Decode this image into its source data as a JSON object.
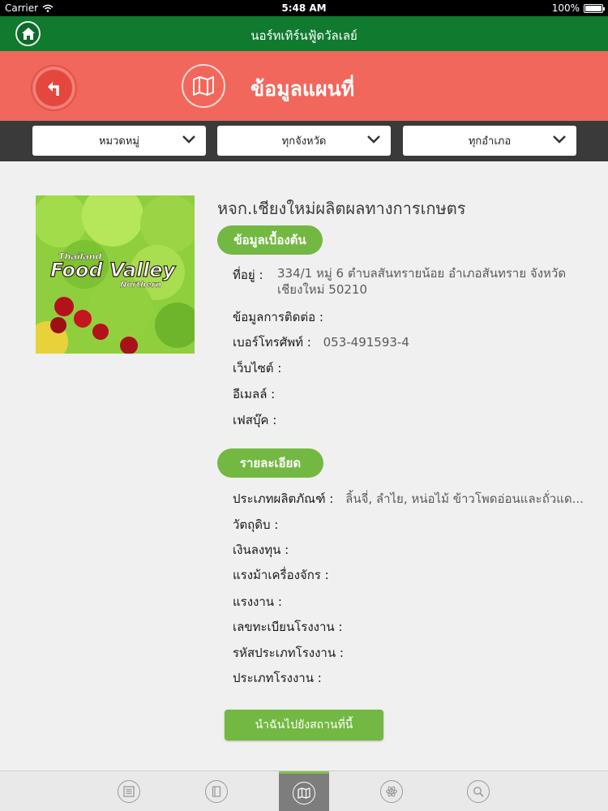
{
  "status_bar": {
    "carrier": "Carrier",
    "time": "5:48 AM",
    "battery": "100%"
  },
  "top_bar": {
    "title": "นอร์ทเทิร์นฟู้ดวัลเลย์"
  },
  "header": {
    "title": "ข้อมูลแผนที่"
  },
  "filters": [
    {
      "label": "หมวดหมู่"
    },
    {
      "label": "ทุกจังหวัด"
    },
    {
      "label": "ทุกอำเภอ"
    }
  ],
  "detail": {
    "company_name": "หจก.เชียงใหม่ผลิตผลทางการเกษตร",
    "image_text": {
      "line1": "Thailand",
      "line2": "Food Valley",
      "line3": "Northern"
    },
    "basic_section": "ข้อมูลเบื้องต้น",
    "address_label": "ที่อยู่ :",
    "address_value": "334/1 หมู่ 6 ตำบลสันทรายน้อย อำเภอสันทราย จังหวัด เชียงใหม่ 50210",
    "contact_label": "ข้อมูลการติดต่อ :",
    "phone_label": "เบอร์โทรศัพท์ :",
    "phone_value": "053-491593-4",
    "website_label": "เว็บไซต์ :",
    "email_label": "อีเมลล์ :",
    "facebook_label": "เฟสบุ๊ค :",
    "detail_section": "รายละเอียด",
    "product_type_label": "ประเภทผลิตภัณฑ์ :",
    "product_type_value": "ลิ้นจี่, ลำไย, หน่อไม้ ข้าวโพดอ่อนและถั่วแด...",
    "raw_material_label": "วัตถุดิบ :",
    "investment_label": "เงินลงทุน :",
    "horsepower_label": "แรงม้าเครื่องจักร :",
    "labor_label": "แรงงาน :",
    "factory_reg_label": "เลขทะเบียนโรงงาน :",
    "factory_code_label": "รหัสประเภทโรงงาน :",
    "factory_type_label": "ประเภทโรงงาน :",
    "navigate_button": "นำฉันไปยังสถานที่นี้"
  },
  "tab_bar": {
    "tabs": [
      {
        "icon": "news-icon",
        "active": false
      },
      {
        "icon": "book-icon",
        "active": false
      },
      {
        "icon": "map-icon",
        "active": true
      },
      {
        "icon": "atom-icon",
        "active": false
      },
      {
        "icon": "search-icon",
        "active": false
      }
    ]
  },
  "colors": {
    "top_bar": "#107a2f",
    "header": "#f2675b",
    "filter_bar": "#3a3a3a",
    "accent_green": "#73b843"
  }
}
